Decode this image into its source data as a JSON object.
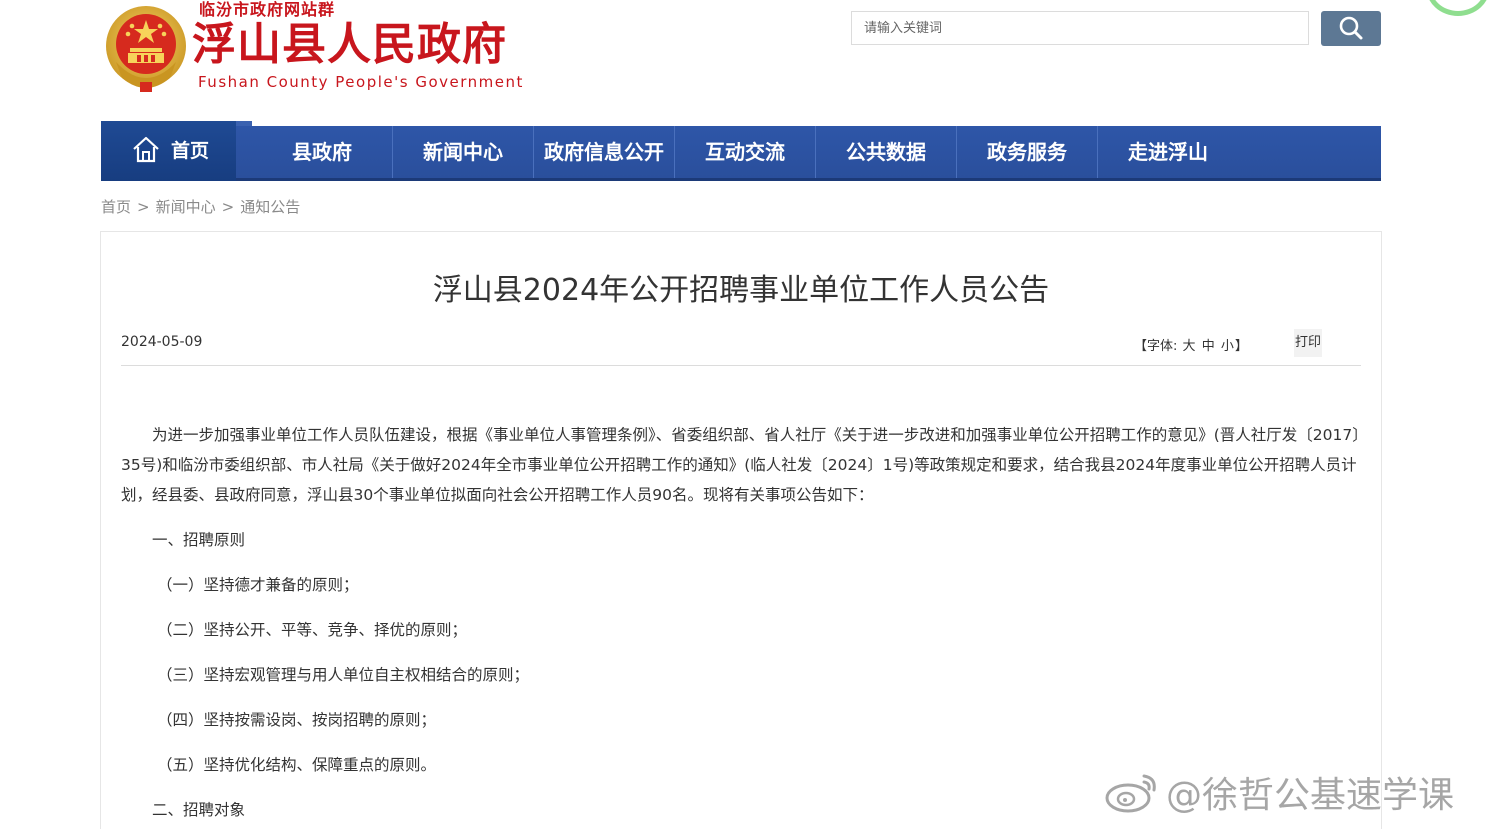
{
  "header": {
    "site_group": "临汾市政府网站群",
    "title": "浮山县人民政府",
    "title_en": "Fushan County People's Government"
  },
  "search": {
    "placeholder": "请输入关键词"
  },
  "nav": {
    "home": "首页",
    "items": [
      "县政府",
      "新闻中心",
      "政府信息公开",
      "互动交流",
      "公共数据",
      "政务服务",
      "走进浮山"
    ]
  },
  "breadcrumb": {
    "home": "首页",
    "news": "新闻中心",
    "current": "通知公告",
    "separator": ">"
  },
  "article": {
    "title": "浮山县2024年公开招聘事业单位工作人员公告",
    "date": "2024-05-09",
    "font_label_prefix": "【字体:",
    "font_large": "大",
    "font_medium": "中",
    "font_small": "小",
    "font_label_suffix": "】",
    "print": "打印",
    "intro": "为进一步加强事业单位工作人员队伍建设，根据《事业单位人事管理条例》、省委组织部、省人社厅《关于进一步改进和加强事业单位公开招聘工作的意见》(晋人社厅发〔2017〕35号)和临汾市委组织部、市人社局《关于做好2024年全市事业单位公开招聘工作的通知》(临人社发〔2024〕1号)等政策规定和要求，结合我县2024年度事业单位公开招聘人员计划，经县委、县政府同意，浮山县30个事业单位拟面向社会公开招聘工作人员90名。现将有关事项公告如下：",
    "section1": "一、招聘原则",
    "p1": "（一）坚持德才兼备的原则；",
    "p2": "（二）坚持公开、平等、竞争、择优的原则；",
    "p3": "（三）坚持宏观管理与用人单位自主权相结合的原则；",
    "p4": "（四）坚持按需设岗、按岗招聘的原则；",
    "p5": "（五）坚持优化结构、保障重点的原则。",
    "section2": "二、招聘对象"
  },
  "watermark": {
    "text": "@徐哲公基速学课"
  },
  "colors": {
    "brand_red": "#c8161d",
    "nav_blue": "#2a4f9c",
    "nav_home": "#1f4a94",
    "search_button": "#5d7894"
  },
  "icons": {
    "emblem": "national-emblem-icon",
    "home": "home-icon",
    "search": "search-icon",
    "weibo": "weibo-icon"
  }
}
